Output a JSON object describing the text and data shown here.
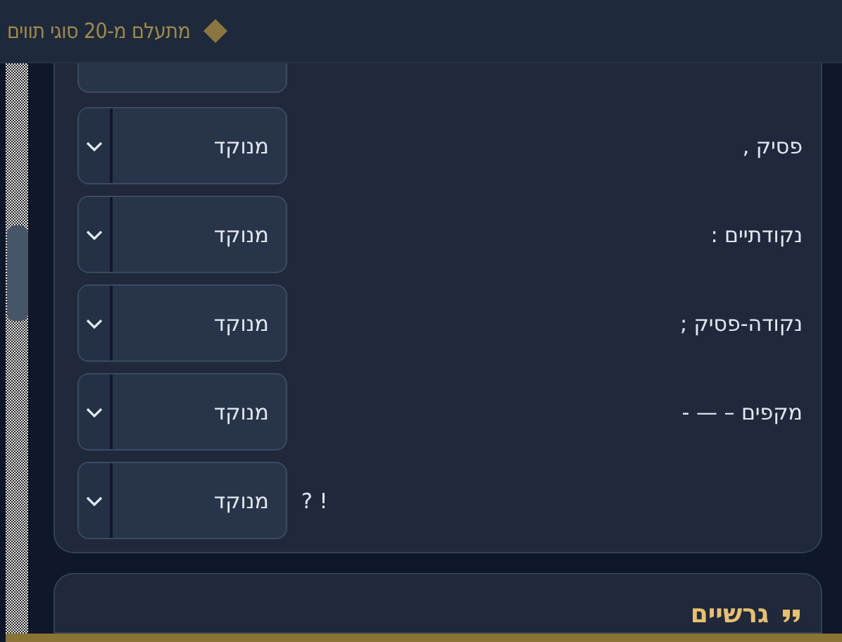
{
  "header": {
    "title": "מתעלם מ-20 סוגי תווים"
  },
  "rows": [
    {
      "label": "פסיק ,",
      "value": "מנוקד",
      "kind": "named"
    },
    {
      "label": "נקודתיים :",
      "value": "מנוקד",
      "kind": "named"
    },
    {
      "label": "נקודה-פסיק ;",
      "value": "מנוקד",
      "kind": "named"
    },
    {
      "label": "מקפים – — -",
      "value": "מנוקד",
      "kind": "named"
    },
    {
      "label": "! ?",
      "value": "מנוקד",
      "kind": "symbols"
    }
  ],
  "next_section": {
    "title": "גרשיים"
  }
}
